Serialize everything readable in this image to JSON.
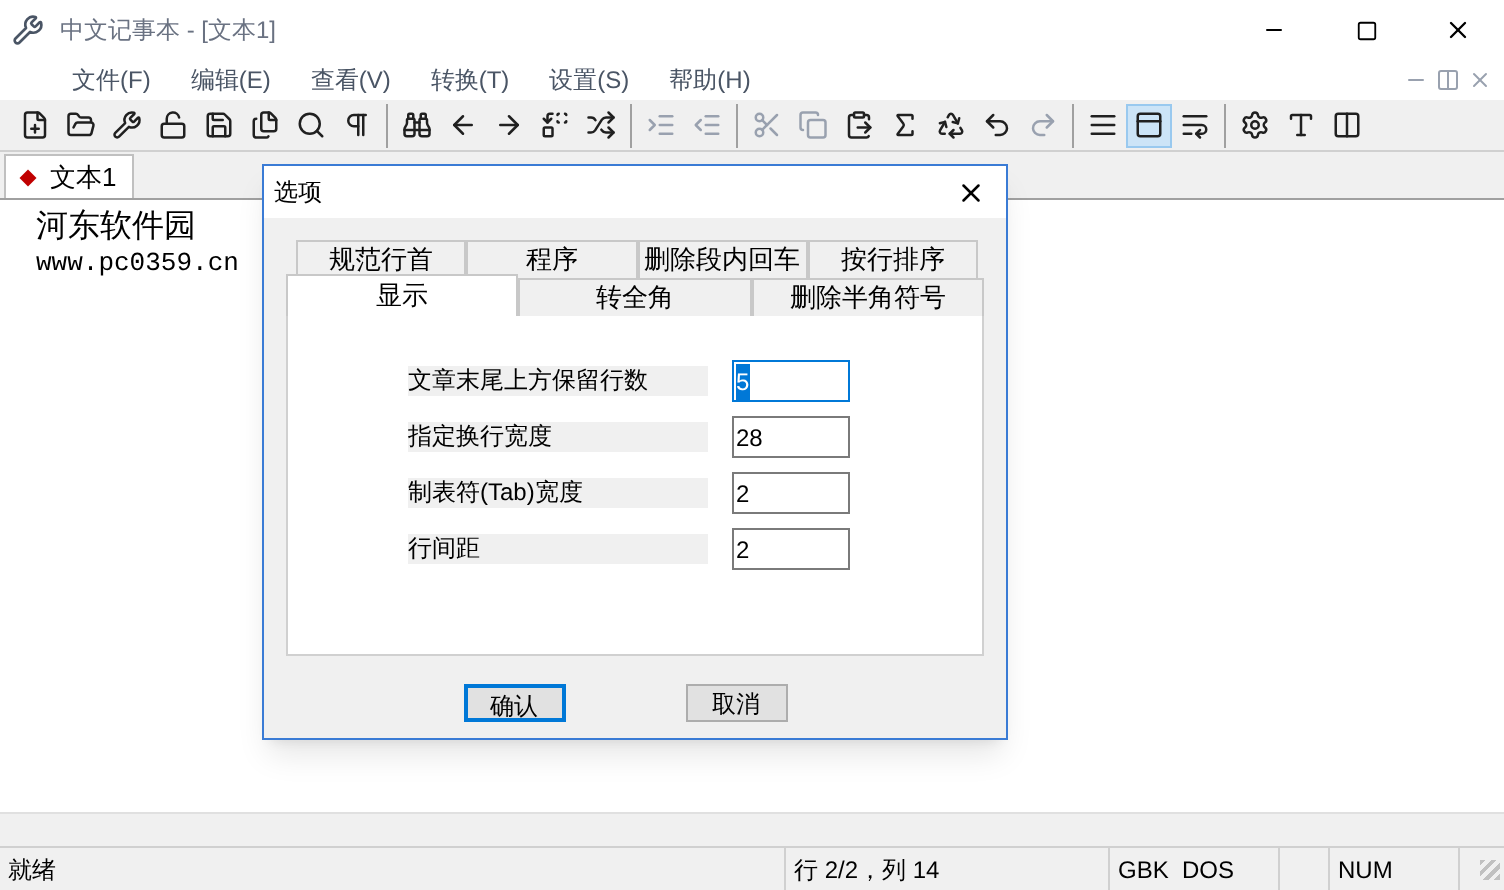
{
  "window": {
    "title": "中文记事本 - [文本1]"
  },
  "menu": [
    {
      "label": "文件(F)"
    },
    {
      "label": "编辑(E)"
    },
    {
      "label": "查看(V)"
    },
    {
      "label": "转换(T)"
    },
    {
      "label": "设置(S)"
    },
    {
      "label": "帮助(H)"
    }
  ],
  "toolbar_groups": [
    {
      "buttons": [
        {
          "pressed": false,
          "disabled": false
        },
        {
          "pressed": false,
          "disabled": false
        },
        {
          "pressed": false,
          "disabled": false
        },
        {
          "pressed": false,
          "disabled": false
        },
        {
          "pressed": false,
          "disabled": false
        },
        {
          "pressed": false,
          "disabled": false
        },
        {
          "pressed": false,
          "disabled": false
        },
        {
          "pressed": false,
          "disabled": false
        }
      ]
    },
    {
      "buttons": [
        {
          "pressed": false,
          "disabled": false
        },
        {
          "pressed": false,
          "disabled": false
        },
        {
          "pressed": false,
          "disabled": false
        },
        {
          "pressed": false,
          "disabled": false
        },
        {
          "pressed": false,
          "disabled": false
        }
      ]
    },
    {
      "buttons": [
        {
          "pressed": false,
          "disabled": true
        },
        {
          "pressed": false,
          "disabled": true
        }
      ]
    },
    {
      "buttons": [
        {
          "pressed": false,
          "disabled": true
        },
        {
          "pressed": false,
          "disabled": true
        },
        {
          "pressed": false,
          "disabled": false
        },
        {
          "pressed": false,
          "disabled": false
        },
        {
          "pressed": false,
          "disabled": false
        },
        {
          "pressed": false,
          "disabled": false
        },
        {
          "pressed": false,
          "disabled": true
        }
      ]
    },
    {
      "buttons": [
        {
          "pressed": false,
          "disabled": false
        },
        {
          "pressed": true,
          "disabled": false
        },
        {
          "pressed": false,
          "disabled": false
        }
      ]
    },
    {
      "buttons": [
        {
          "pressed": false,
          "disabled": false
        },
        {
          "pressed": false,
          "disabled": false
        },
        {
          "pressed": false,
          "disabled": false
        }
      ]
    }
  ],
  "doc_tabs": [
    {
      "label": "文本1",
      "selected": true
    }
  ],
  "document": {
    "lines": [
      "河东软件园",
      "www.pc0359.cn"
    ]
  },
  "dialog": {
    "title": "选项",
    "tab_rows": [
      [
        {
          "label": "规范行首",
          "selected": false
        },
        {
          "label": "程序",
          "selected": false
        },
        {
          "label": "删除段内回车",
          "selected": false
        },
        {
          "label": "按行排序",
          "selected": false
        }
      ],
      [
        {
          "label": "显示",
          "selected": true
        },
        {
          "label": "转全角",
          "selected": false
        },
        {
          "label": "删除半角符号",
          "selected": false
        }
      ]
    ],
    "fields": [
      {
        "label": "文章末尾上方保留行数",
        "value": "5",
        "selected": true
      },
      {
        "label": "指定换行宽度",
        "value": "28",
        "selected": false
      },
      {
        "label": "制表符(Tab)宽度",
        "value": "2",
        "selected": false
      },
      {
        "label": "行间距",
        "value": "2",
        "selected": false
      }
    ],
    "buttons": [
      {
        "label": "确认",
        "kind": "default"
      },
      {
        "label": "取消",
        "kind": "normal"
      }
    ]
  },
  "status_bar": [
    {
      "text": "就绪"
    },
    {
      "text": "行 2/2，列 14"
    },
    {
      "text": "GBK  DOS"
    },
    {
      "text": "NUM"
    }
  ]
}
